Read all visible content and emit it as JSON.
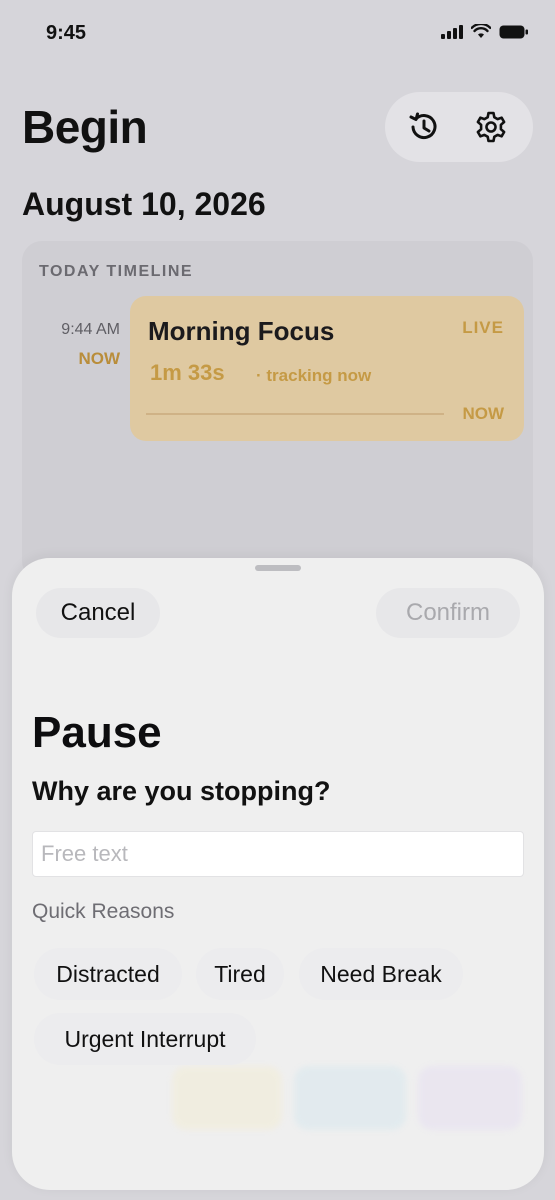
{
  "status_bar": {
    "time": "9:45"
  },
  "header": {
    "title": "Begin",
    "date": "August 10, 2026",
    "actions": [
      {
        "icon": "history-icon"
      },
      {
        "icon": "gear-icon"
      }
    ]
  },
  "timeline": {
    "heading": "TODAY TIMELINE",
    "entry": {
      "time": "9:44 AM",
      "marker": "NOW",
      "title": "Morning Focus",
      "live_badge": "LIVE",
      "elapsed": "1m 33s",
      "status": "· tracking now",
      "end_marker": "NOW"
    }
  },
  "sheet": {
    "cancel_label": "Cancel",
    "confirm_label": "Confirm",
    "title": "Pause",
    "question": "Why are you stopping?",
    "input_placeholder": "Free text",
    "input_value": "",
    "quick_reasons_label": "Quick Reasons",
    "quick_reasons": [
      "Distracted",
      "Tired",
      "Need Break",
      "Urgent Interrupt"
    ]
  },
  "colors": {
    "accent": "#c59a45",
    "session_bg": "#dfc9a1",
    "background": "#d6d5da",
    "sheet_bg": "#efefef",
    "disabled_text": "#a9a9ad"
  }
}
